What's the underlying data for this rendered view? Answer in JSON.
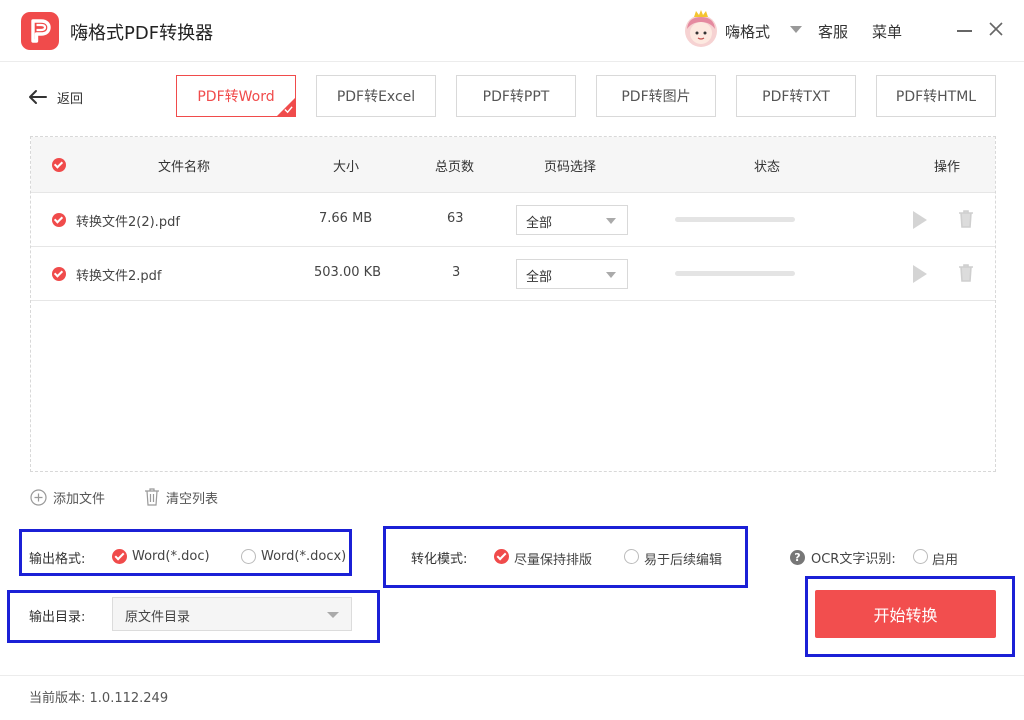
{
  "app": {
    "title": "嗨格式PDF转换器",
    "username": "嗨格式",
    "service_label": "客服",
    "menu_label": "菜单",
    "accent_color": "#f04b4b"
  },
  "nav": {
    "back_label": "返回",
    "tabs": [
      {
        "label": "PDF转Word",
        "active": true
      },
      {
        "label": "PDF转Excel",
        "active": false
      },
      {
        "label": "PDF转PPT",
        "active": false
      },
      {
        "label": "PDF转图片",
        "active": false
      },
      {
        "label": "PDF转TXT",
        "active": false
      },
      {
        "label": "PDF转HTML",
        "active": false
      }
    ]
  },
  "table": {
    "headers": {
      "name": "文件名称",
      "size": "大小",
      "pages": "总页数",
      "page_select": "页码选择",
      "status": "状态",
      "actions": "操作"
    },
    "rows": [
      {
        "name": "转换文件2(2).pdf",
        "size": "7.66 MB",
        "pages": "63",
        "page_select": "全部",
        "progress": 0
      },
      {
        "name": "转换文件2.pdf",
        "size": "503.00 KB",
        "pages": "3",
        "page_select": "全部",
        "progress": 0
      }
    ]
  },
  "actions": {
    "add_file": "添加文件",
    "clear_list": "清空列表"
  },
  "options": {
    "format_label": "输出格式:",
    "format_doc": "Word(*.doc)",
    "format_docx": "Word(*.docx)",
    "mode_label": "转化模式:",
    "mode_keep_layout": "尽量保持排版",
    "mode_editable": "易于后续编辑",
    "ocr_label": "OCR文字识别:",
    "ocr_enable": "启用",
    "dir_label": "输出目录:",
    "dir_value": "原文件目录",
    "start_button": "开始转换",
    "highlight_color": "#1b20d6"
  },
  "footer": {
    "version_label": "当前版本:",
    "version_value": "1.0.112.249"
  }
}
